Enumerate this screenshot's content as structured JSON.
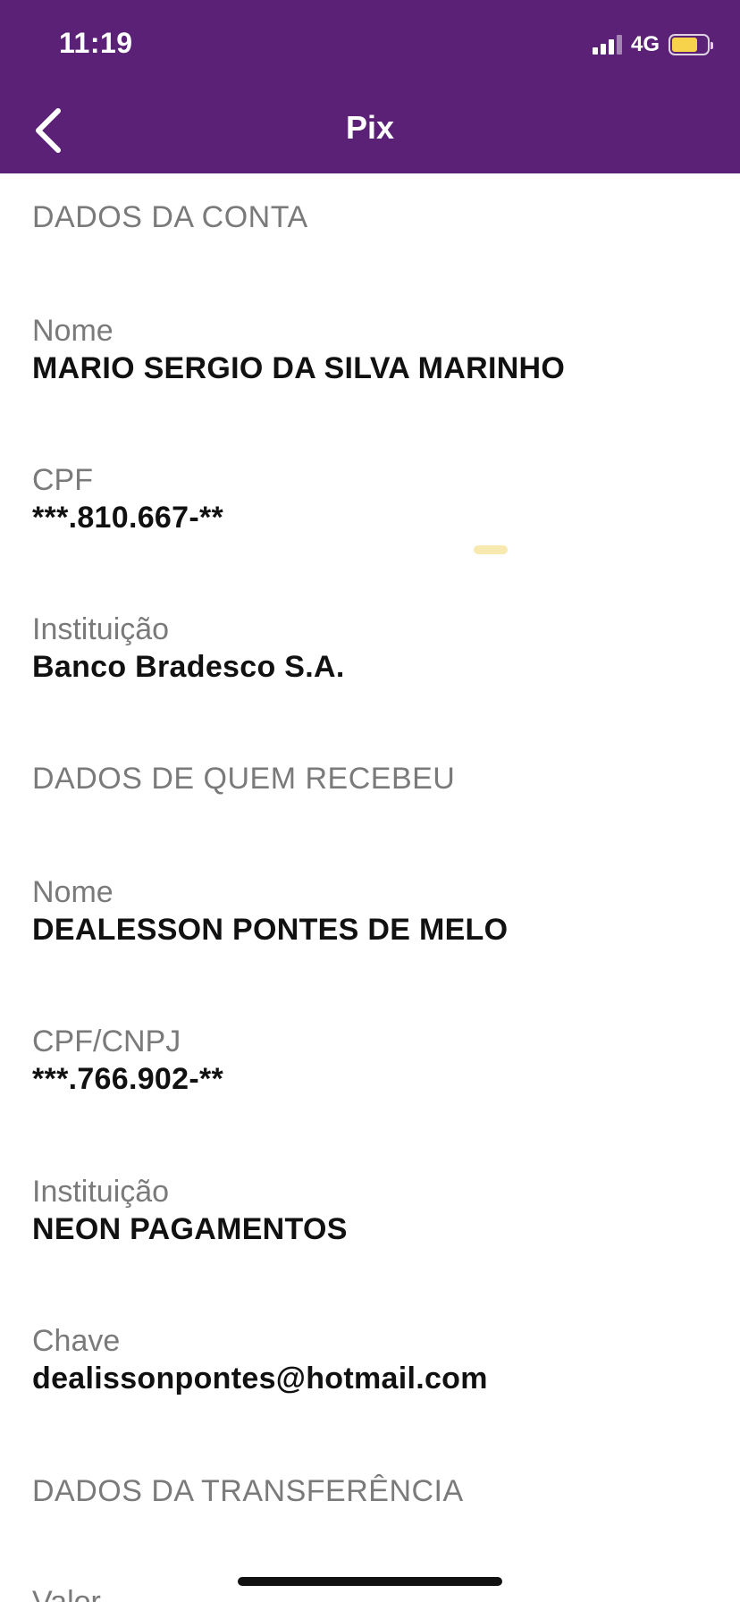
{
  "status_bar": {
    "time": "11:19",
    "network": "4G"
  },
  "nav": {
    "title": "Pix"
  },
  "sections": {
    "conta": {
      "title": "DADOS DA CONTA",
      "nome": {
        "label": "Nome",
        "value": "MARIO SERGIO DA SILVA MARINHO"
      },
      "cpf": {
        "label": "CPF",
        "value": "***.810.667-**"
      },
      "instituicao": {
        "label": "Instituição",
        "value": "Banco Bradesco S.A."
      }
    },
    "recebedor": {
      "title": "DADOS DE QUEM RECEBEU",
      "nome": {
        "label": "Nome",
        "value": "DEALESSON PONTES DE MELO"
      },
      "cpf_cnpj": {
        "label": "CPF/CNPJ",
        "value": "***.766.902-**"
      },
      "instituicao": {
        "label": "Instituição",
        "value": "NEON PAGAMENTOS"
      },
      "chave": {
        "label": "Chave",
        "value": "dealissonpontes@hotmail.com"
      }
    },
    "transferencia": {
      "title": "DADOS DA TRANSFERÊNCIA",
      "valor": {
        "label": "Valor"
      }
    }
  },
  "colors": {
    "header": "#5a2176",
    "label": "#7a7a7a",
    "value": "#111111",
    "battery": "#f6d34a"
  }
}
